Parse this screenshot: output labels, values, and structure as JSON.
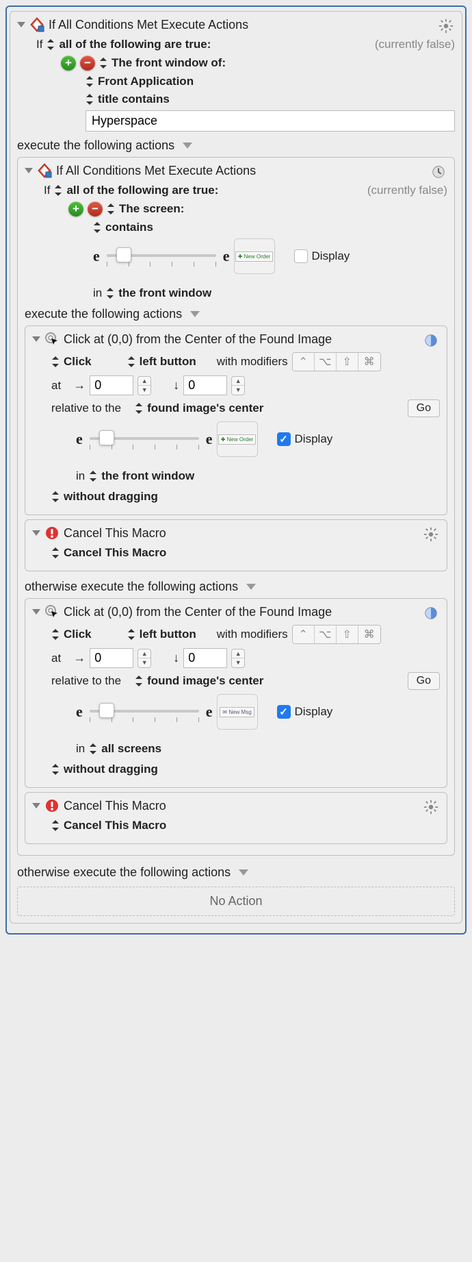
{
  "outer": {
    "title": "If All Conditions Met Execute Actions",
    "if_label": "If",
    "selector_label": "all of the following are true:",
    "status": "(currently false)",
    "cond": {
      "line1": "The front window of:",
      "line2": "Front Application",
      "line3": "title contains",
      "value": "Hyperspace"
    },
    "execute_label": "execute the following actions"
  },
  "inner_if": {
    "title": "If All Conditions Met Execute Actions",
    "if_label": "If",
    "selector_label": "all of the following are true:",
    "status": "(currently false)",
    "cond": {
      "line1": "The screen:",
      "line2": "contains",
      "thumb": "New Order",
      "display_label": "Display",
      "display_checked": false,
      "in_label": "in",
      "scope": "the front window"
    },
    "execute_label": "execute the following actions"
  },
  "click1": {
    "title": "Click at (0,0) from the Center of the Found Image",
    "click_label": "Click",
    "button_label": "left button",
    "with_mod": "with modifiers",
    "at_label": "at",
    "x": "0",
    "y": "0",
    "rel_label": "relative to the",
    "rel_target": "found image's center",
    "go": "Go",
    "thumb": "New Order",
    "display_label": "Display",
    "display_checked": true,
    "in_label": "in",
    "scope": "the front window",
    "drag": "without dragging"
  },
  "cancel1": {
    "title": "Cancel This Macro",
    "option": "Cancel This Macro"
  },
  "otherwise1": "otherwise execute the following actions",
  "click2": {
    "title": "Click at (0,0) from the Center of the Found Image",
    "click_label": "Click",
    "button_label": "left button",
    "with_mod": "with modifiers",
    "at_label": "at",
    "x": "0",
    "y": "0",
    "rel_label": "relative to the",
    "rel_target": "found image's center",
    "go": "Go",
    "thumb": "New Msg",
    "display_label": "Display",
    "display_checked": true,
    "in_label": "in",
    "scope": "all screens",
    "drag": "without dragging"
  },
  "cancel2": {
    "title": "Cancel This Macro",
    "option": "Cancel This Macro"
  },
  "otherwise2": "otherwise execute the following actions",
  "noaction": "No Action"
}
